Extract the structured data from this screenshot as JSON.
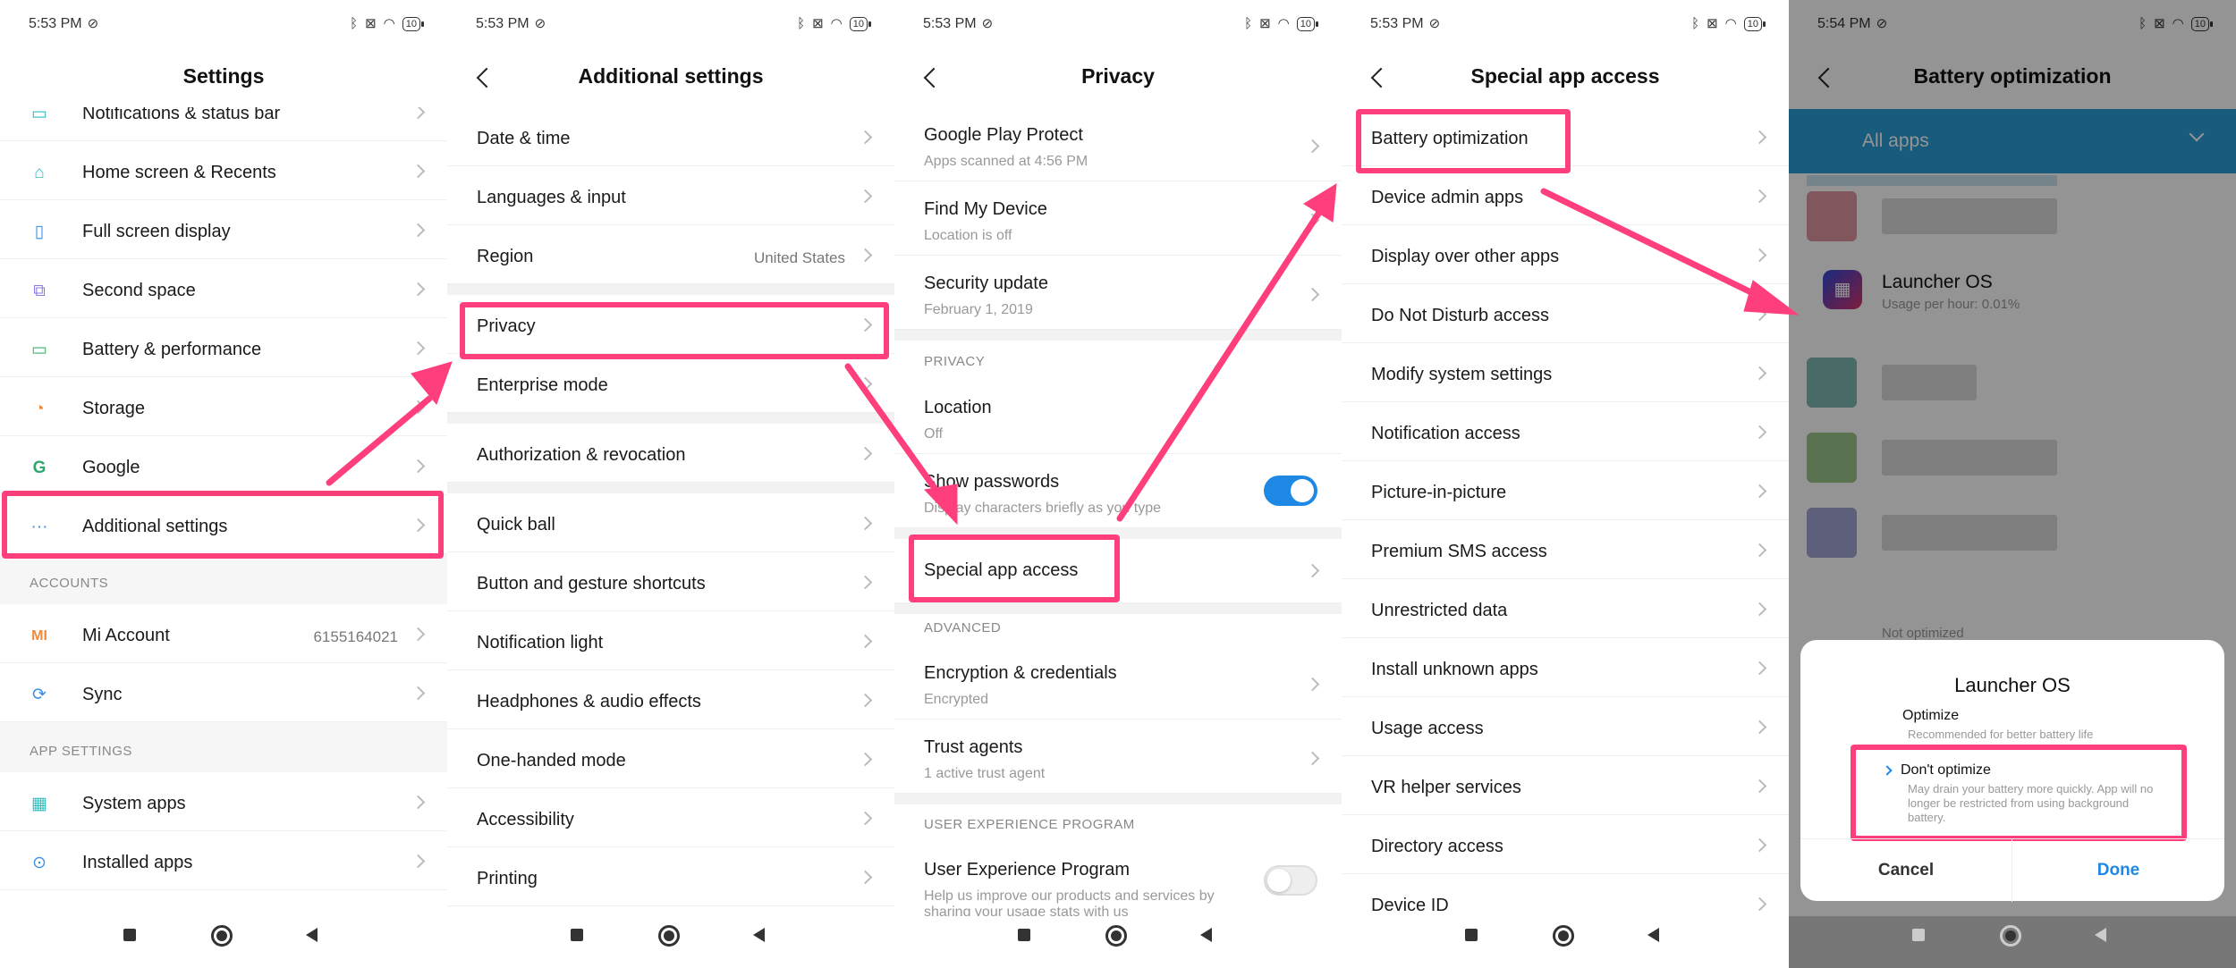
{
  "status": {
    "time_1": "5:53 PM",
    "time_2": "5:53 PM",
    "time_3": "5:53 PM",
    "time_4": "5:53 PM",
    "time_5": "5:54 PM",
    "battery": "10"
  },
  "screen1": {
    "title": "Settings",
    "items": [
      {
        "label": "Notifications & status bar"
      },
      {
        "label": "Home screen & Recents"
      },
      {
        "label": "Full screen display"
      },
      {
        "label": "Second space"
      },
      {
        "label": "Battery & performance"
      },
      {
        "label": "Storage"
      },
      {
        "label": "Google"
      },
      {
        "label": "Additional settings"
      }
    ],
    "accounts_header": "ACCOUNTS",
    "mi_account": {
      "label": "Mi Account",
      "value": "6155164021"
    },
    "sync": {
      "label": "Sync"
    },
    "app_settings_header": "APP SETTINGS",
    "system_apps": {
      "label": "System apps"
    },
    "installed_apps": {
      "label": "Installed apps"
    }
  },
  "screen2": {
    "title": "Additional settings",
    "items": [
      {
        "label": "Date & time"
      },
      {
        "label": "Languages & input"
      },
      {
        "label": "Region",
        "value": "United States"
      },
      {
        "label": "Privacy"
      },
      {
        "label": "Enterprise mode"
      },
      {
        "label": "Authorization & revocation"
      },
      {
        "label": "Quick ball"
      },
      {
        "label": "Button and gesture shortcuts"
      },
      {
        "label": "Notification light"
      },
      {
        "label": "Headphones & audio effects"
      },
      {
        "label": "One-handed mode"
      },
      {
        "label": "Accessibility"
      },
      {
        "label": "Printing"
      }
    ]
  },
  "screen3": {
    "title": "Privacy",
    "play_protect": {
      "label": "Google Play Protect",
      "sub": "Apps scanned at 4:56 PM"
    },
    "find_device": {
      "label": "Find My Device",
      "sub": "Location is off"
    },
    "security_update": {
      "label": "Security update",
      "sub": "February 1, 2019"
    },
    "privacy_header": "PRIVACY",
    "location": {
      "label": "Location",
      "sub": "Off"
    },
    "show_passwords": {
      "label": "Show passwords",
      "sub": "Display characters briefly as you type",
      "enabled": true
    },
    "special_access": {
      "label": "Special app access"
    },
    "advanced_header": "ADVANCED",
    "encryption": {
      "label": "Encryption & credentials",
      "sub": "Encrypted"
    },
    "trust_agents": {
      "label": "Trust agents",
      "sub": "1 active trust agent"
    },
    "uxp_header": "USER EXPERIENCE PROGRAM",
    "uxp": {
      "label": "User Experience Program",
      "sub": "Help us improve our products and services by sharing your usage stats with us",
      "enabled": false
    }
  },
  "screen4": {
    "title": "Special app access",
    "items": [
      {
        "label": "Battery optimization"
      },
      {
        "label": "Device admin apps"
      },
      {
        "label": "Display over other apps"
      },
      {
        "label": "Do Not Disturb access"
      },
      {
        "label": "Modify system settings"
      },
      {
        "label": "Notification access"
      },
      {
        "label": "Picture-in-picture"
      },
      {
        "label": "Premium SMS access"
      },
      {
        "label": "Unrestricted data"
      },
      {
        "label": "Install unknown apps"
      },
      {
        "label": "Usage access"
      },
      {
        "label": "VR helper services"
      },
      {
        "label": "Directory access"
      },
      {
        "label": "Device ID"
      }
    ]
  },
  "screen5": {
    "title": "Battery optimization",
    "filter": "All apps",
    "app": {
      "name": "Launcher OS",
      "usage": "Usage per hour: 0.01%"
    },
    "partial_item": "Not optimized",
    "dialog": {
      "title": "Launcher OS",
      "optimize": "Optimize",
      "optimize_sub": "Recommended for better battery life",
      "dont_optimize": "Don't optimize",
      "dont_optimize_sub": "May drain your battery more quickly. App will no longer be restricted from using background battery.",
      "cancel": "Cancel",
      "done": "Done"
    }
  },
  "colors": {
    "highlight": "#ff3e7c",
    "accent": "#1e88e5",
    "filter_bar": "#2b9ed8"
  }
}
